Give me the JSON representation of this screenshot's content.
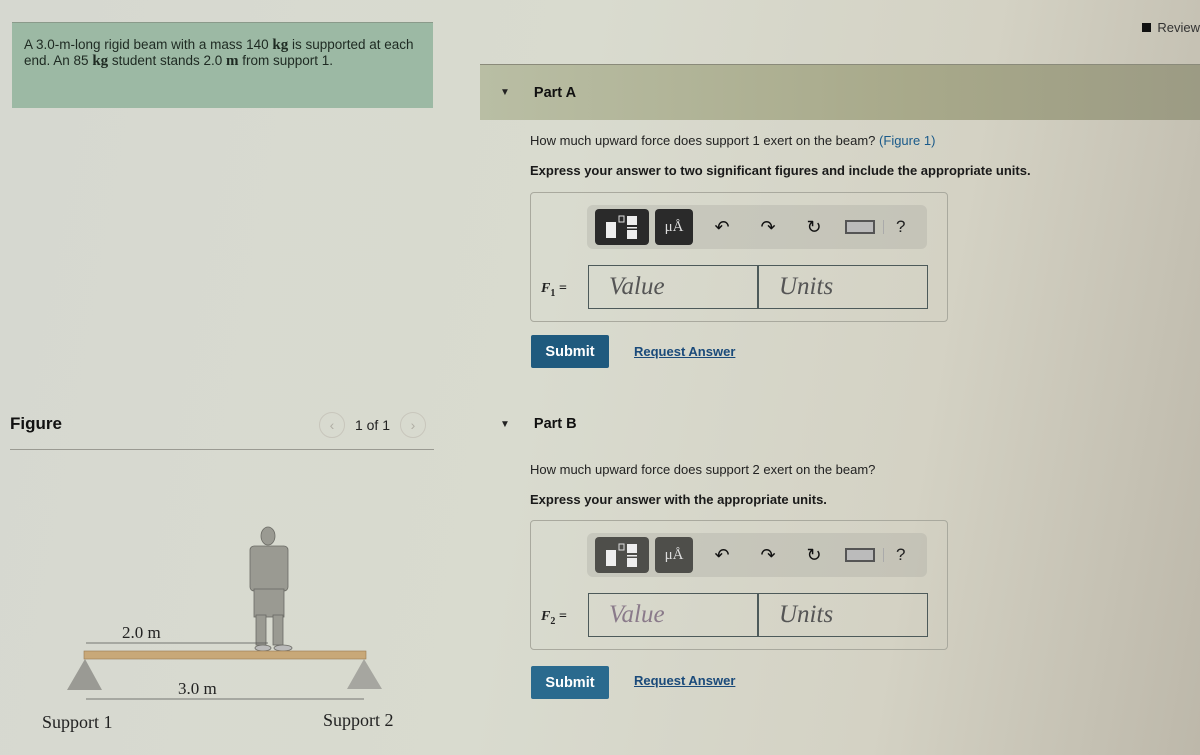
{
  "problem": {
    "segments": [
      {
        "t": "A 3.0-m-long rigid beam with a mass 140 ",
        "u": false
      },
      {
        "t": "kg",
        "u": true
      },
      {
        "t": " is supported at each end. An 85 ",
        "u": false
      },
      {
        "t": "kg",
        "u": true
      },
      {
        "t": " student stands 2.0 ",
        "u": false
      },
      {
        "t": "m",
        "u": true
      },
      {
        "t": " from support 1.",
        "u": false
      }
    ]
  },
  "review": {
    "label": "Review"
  },
  "figure": {
    "title": "Figure",
    "counter": "1 of 1",
    "prev_icon": "chevron-left",
    "next_icon": "chevron-right",
    "labels": {
      "distance_student": "2.0 m",
      "distance_beam": "3.0 m",
      "support1": "Support 1",
      "support2": "Support 2"
    }
  },
  "parts": [
    {
      "title": "Part A",
      "question": "How much upward force does support 1 exert on the beam?",
      "figure_link": "(Figure 1)",
      "instruction": "Express your answer to two significant figures and include the appropriate units.",
      "var_symbol": "F",
      "var_sub": "1",
      "value_placeholder": "Value",
      "units_placeholder": "Units",
      "submit_label": "Submit",
      "request_label": "Request Answer"
    },
    {
      "title": "Part B",
      "question": "How much upward force does support 2 exert on the beam?",
      "figure_link": "",
      "instruction": "Express your answer with the appropriate units.",
      "var_symbol": "F",
      "var_sub": "2",
      "value_placeholder": "Value",
      "units_placeholder": "Units",
      "submit_label": "Submit",
      "request_label": "Request Answer"
    }
  ],
  "toolbar": {
    "units_label": "μÅ",
    "undo_icon": "undo-icon",
    "redo_icon": "redo-icon",
    "reset_icon": "reset-icon",
    "keyboard_icon": "keyboard-icon",
    "help_label": "?"
  }
}
